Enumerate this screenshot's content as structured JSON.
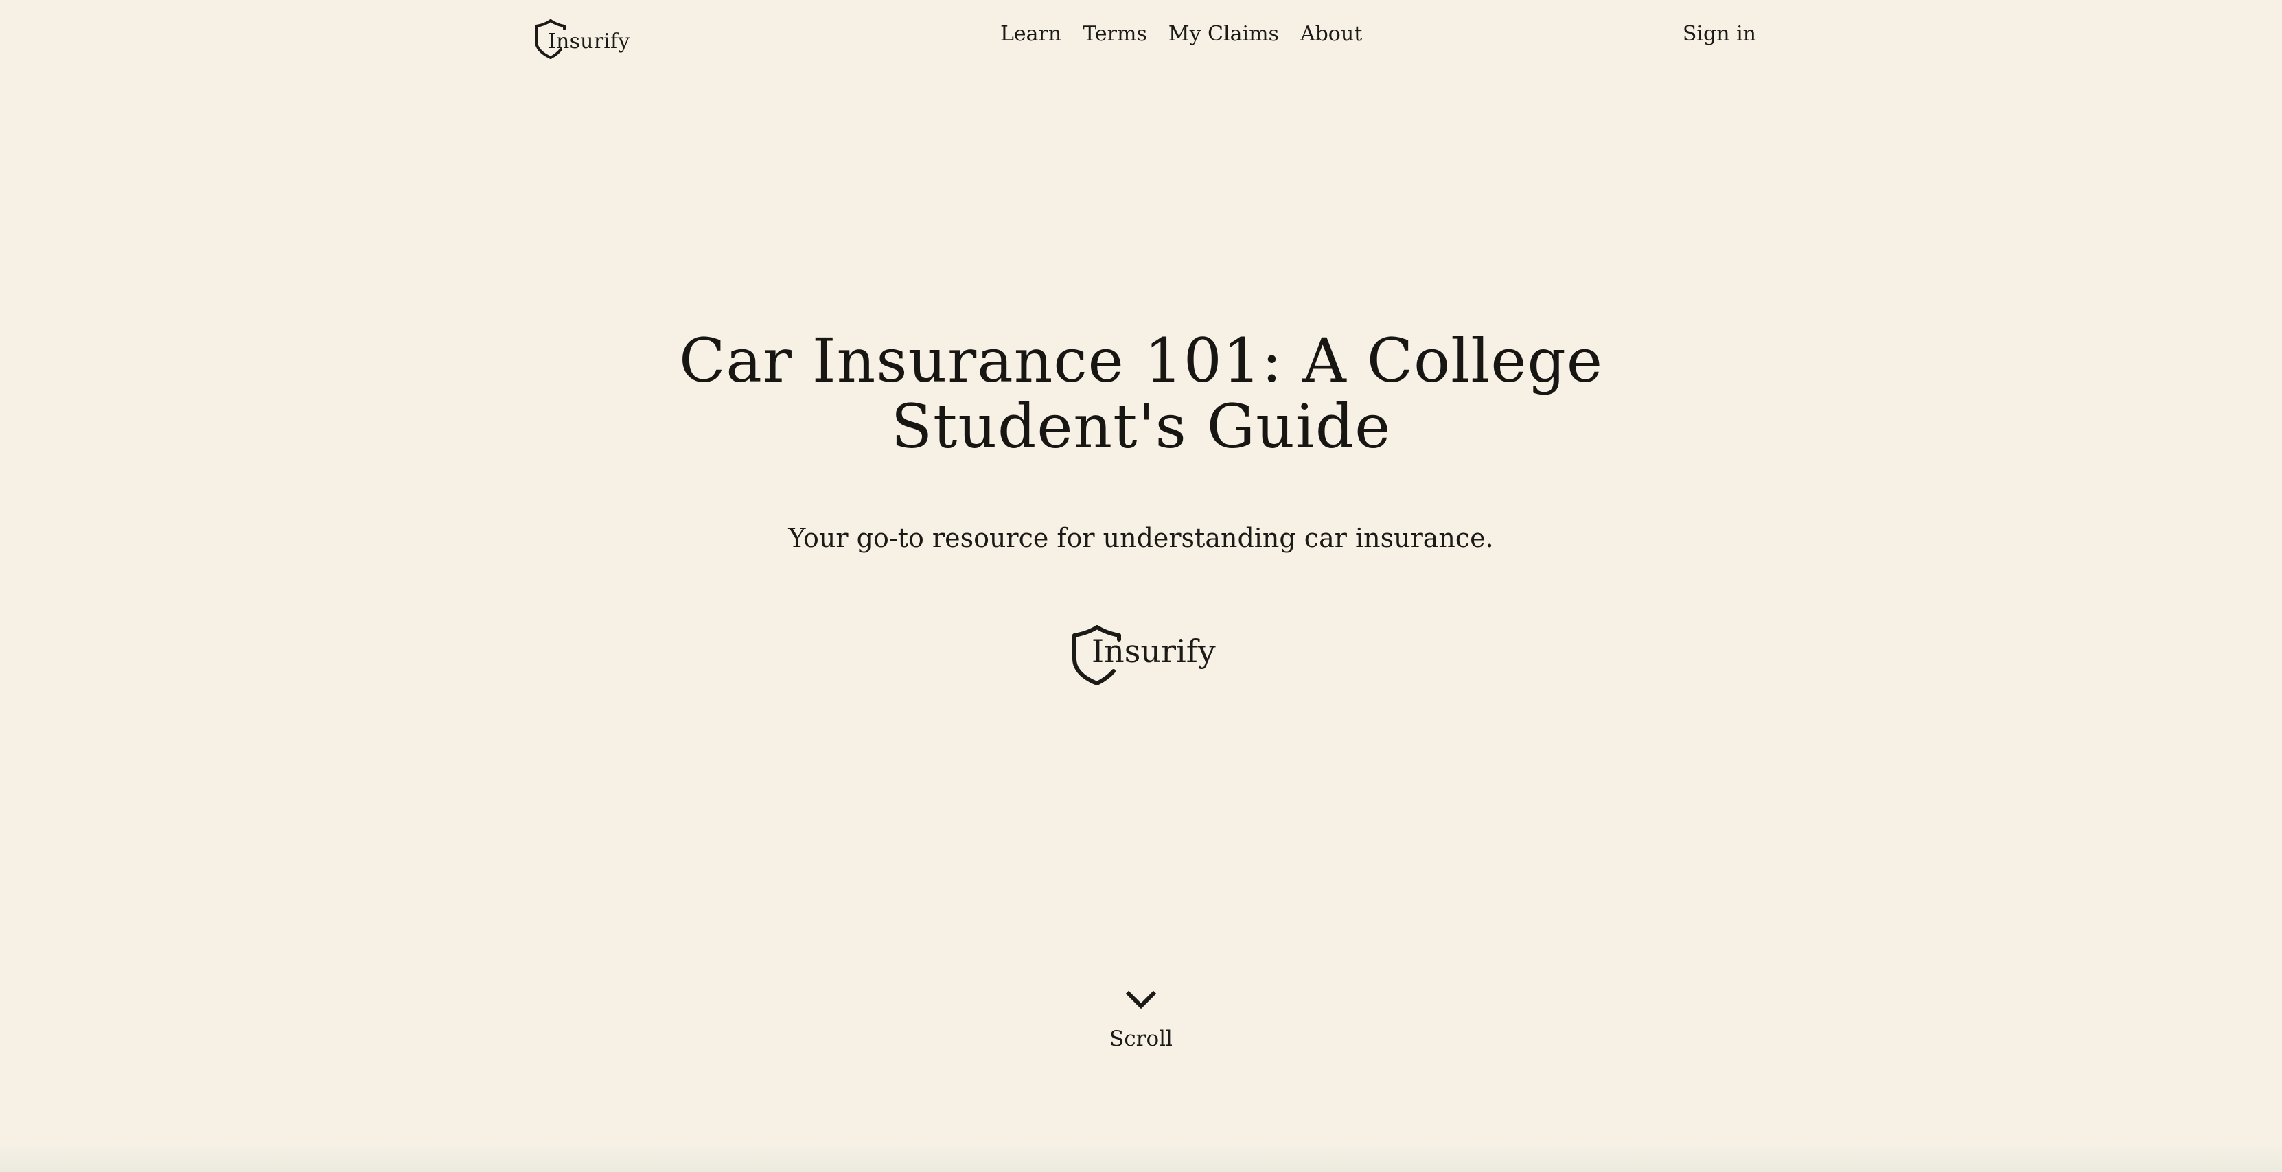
{
  "header": {
    "brand": "Insurify",
    "nav": [
      "Learn",
      "Terms",
      "My Claims",
      "About"
    ],
    "signin_label": "Sign in"
  },
  "hero": {
    "title": "Car Insurance 101: A College Student's Guide",
    "subtitle": "Your go-to resource for understanding car insurance.",
    "logo_text": "Insurify"
  },
  "scroll": {
    "label": "Scroll"
  },
  "colors": {
    "background": "#f6f0e5",
    "text": "#1c1a17"
  },
  "icons": {
    "brand": "shield-icon",
    "scroll": "chevron-down-icon"
  }
}
